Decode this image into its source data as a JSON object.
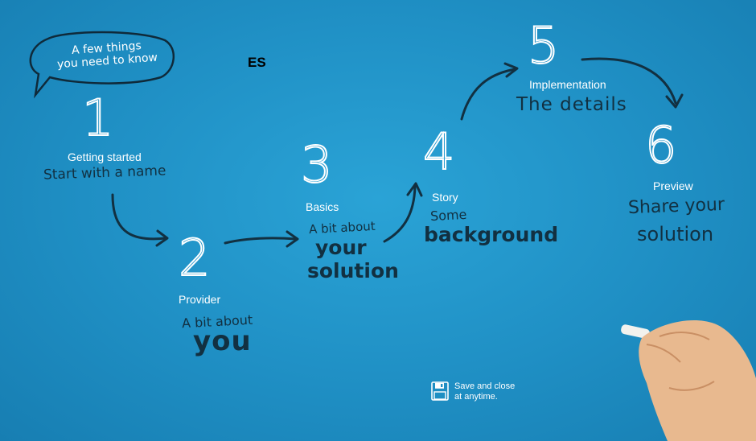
{
  "header": {
    "language_code": "ES"
  },
  "intro": {
    "line1": "A few things",
    "line2": "you need to know"
  },
  "steps": [
    {
      "num": "1",
      "title": "Getting started",
      "desc": "Start with a name"
    },
    {
      "num": "2",
      "title": "Provider",
      "desc1": "A bit about",
      "desc2": "you"
    },
    {
      "num": "3",
      "title": "Basics",
      "desc1": "A bit about",
      "desc2": "your",
      "desc3": "solution"
    },
    {
      "num": "4",
      "title": "Story",
      "desc1": "Some",
      "desc2": "background"
    },
    {
      "num": "5",
      "title": "Implementation",
      "desc": "The details"
    },
    {
      "num": "6",
      "title": "Preview",
      "desc1": "Share your",
      "desc2": "solution"
    }
  ],
  "footer": {
    "save_line1": "Save and close",
    "save_line2": "at anytime.",
    "save_icon": "floppy-disk-icon"
  },
  "colors": {
    "background": "#1f8fc4",
    "chalk": "#ffffff",
    "ink": "#123041"
  }
}
